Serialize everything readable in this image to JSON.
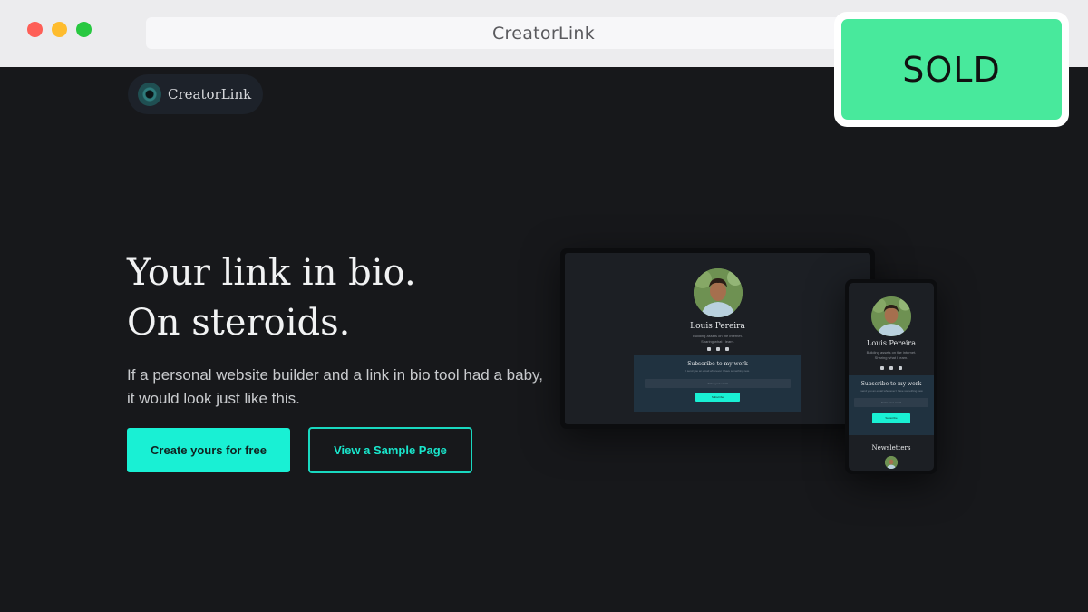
{
  "browser": {
    "url_title": "CreatorLink"
  },
  "badge": {
    "label": "SOLD",
    "color": "#48e99c"
  },
  "brand": {
    "name": "CreatorLink"
  },
  "hero": {
    "title_line1": "Your link in bio.",
    "title_line2": "On steroids.",
    "subtitle": "If a personal website builder and a link in bio tool had a baby, it would look just like this.",
    "primary_cta": "Create yours for free",
    "secondary_cta": "View a Sample Page",
    "accent_color": "#19f0d4"
  },
  "mockup": {
    "profile_name": "Louis Pereira",
    "bio_line1": "Building assets on the internet.",
    "bio_line2": "Sharing what I learn.",
    "social_icons": [
      "twitter-icon",
      "linkedin-icon",
      "instagram-icon"
    ],
    "subscribe_title": "Subscribe to my work",
    "subscribe_desc": "I send you an email whenever I have something new.",
    "email_placeholder": "Enter your email",
    "subscribe_button": "Subscribe",
    "newsletters_title": "Newsletters"
  }
}
